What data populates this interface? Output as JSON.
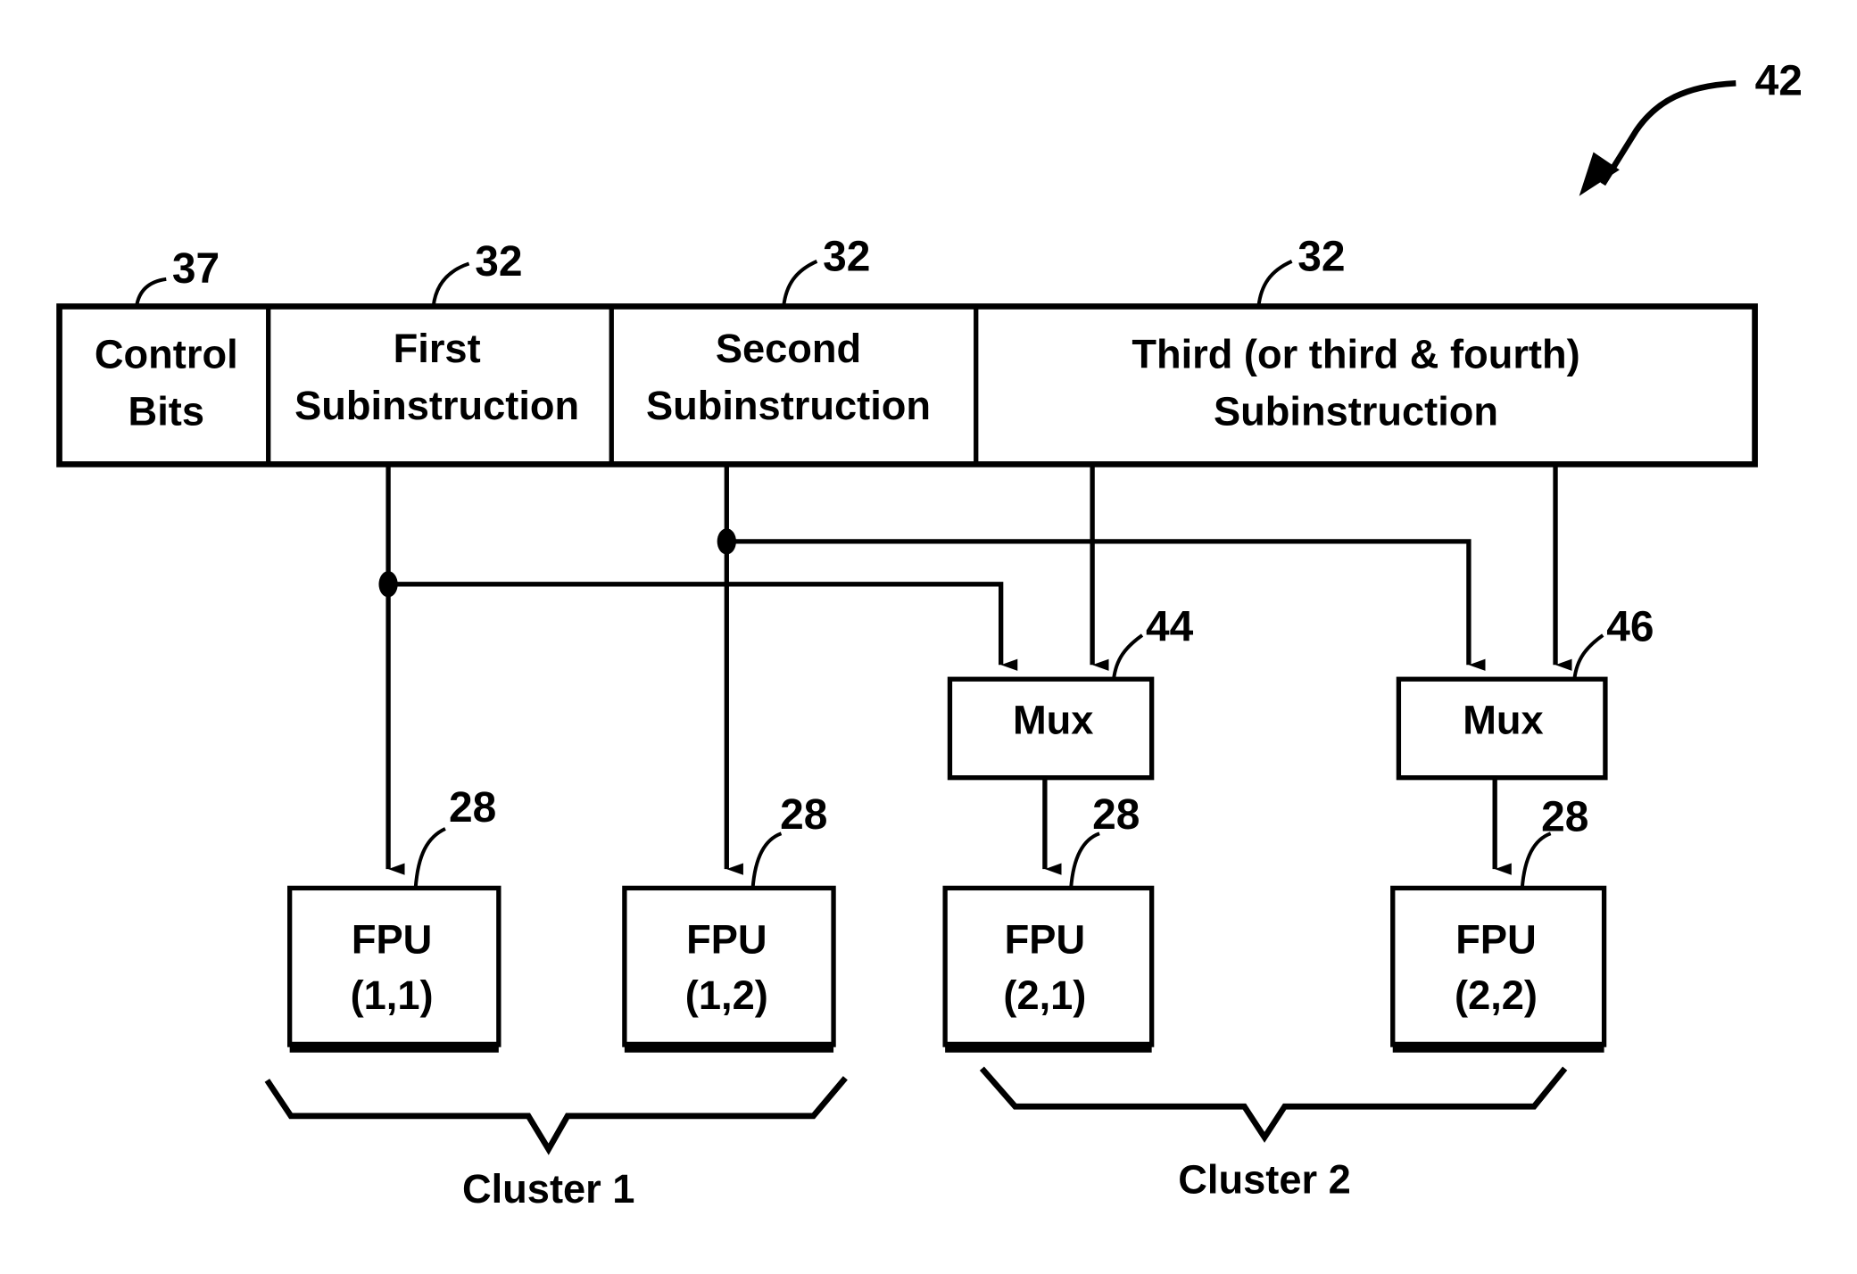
{
  "figure_ref": "42",
  "instruction_word": {
    "fields": [
      {
        "ref": "37",
        "lines": [
          "Control",
          "Bits"
        ]
      },
      {
        "ref": "32",
        "lines": [
          "First",
          "Subinstruction"
        ]
      },
      {
        "ref": "32",
        "lines": [
          "Second",
          "Subinstruction"
        ]
      },
      {
        "ref": "32",
        "lines": [
          "Third (or third & fourth)",
          "Subinstruction"
        ]
      }
    ]
  },
  "muxes": [
    {
      "ref": "44",
      "label": "Mux"
    },
    {
      "ref": "46",
      "label": "Mux"
    }
  ],
  "fpus": [
    {
      "ref": "28",
      "lines": [
        "FPU",
        "(1,1)"
      ]
    },
    {
      "ref": "28",
      "lines": [
        "FPU",
        "(1,2)"
      ]
    },
    {
      "ref": "28",
      "lines": [
        "FPU",
        "(2,1)"
      ]
    },
    {
      "ref": "28",
      "lines": [
        "FPU",
        "(2,2)"
      ]
    }
  ],
  "clusters": [
    {
      "label": "Cluster 1"
    },
    {
      "label": "Cluster 2"
    }
  ],
  "colors": {
    "ink": "#000000",
    "paper": "#ffffff"
  }
}
